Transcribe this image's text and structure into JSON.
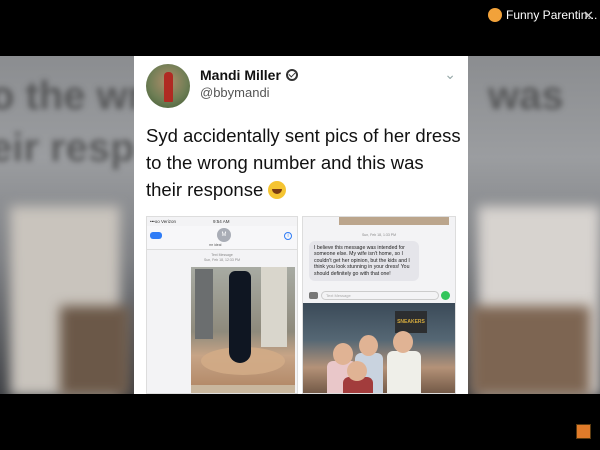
{
  "overlay": {
    "title": "Funny Parentin...",
    "channel_icon": "channel-avatar-icon",
    "close_icon": "close-icon"
  },
  "background_text": {
    "line1_left": "o the wr",
    "line1_right": "was",
    "line2_left": "eir resp"
  },
  "tweet": {
    "author_name": "Mandi Miller",
    "author_handle": "@bbymandi",
    "text": "Syd accidentally sent pics of her dress to the wrong number and this was their response",
    "emoji": "laughing-tears-emoji"
  },
  "screenshot_left": {
    "status_left": "•••oo Verizon",
    "status_time": "9:54 AM",
    "contact_initial": "M",
    "contact_label": "mr ideal",
    "meta_line1": "Text Message",
    "meta_line2": "Sun, Feb 18, 12:33 PM"
  },
  "screenshot_right": {
    "date": "Sun, Feb 18, 1:33 PM",
    "reply": "I believe this message was intended for someone else. My wife isn't home, so I couldn't get her opinion, but the kids and I think you look stunning in your dress! You should definitely go with that one!",
    "composer_placeholder": "Text Message",
    "poster_text": "SNEAKERS"
  },
  "colors": {
    "ios_blue": "#2f7cf6",
    "send_green": "#33c55b",
    "dress": "#0f1622"
  }
}
